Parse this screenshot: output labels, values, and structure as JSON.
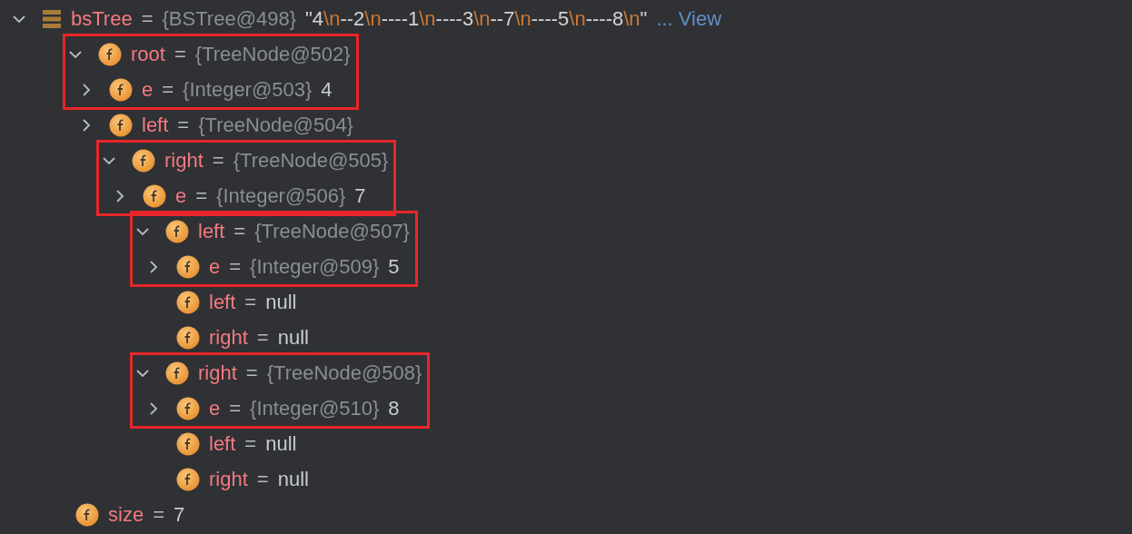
{
  "tree": [
    {
      "kind": "object",
      "name": "bsTree",
      "sep": "=",
      "expanded": true,
      "ref": "{BSTree@498}",
      "string": "\"4\\n--2\\n----1\\n----3\\n--7\\n----5\\n----8\\n\"",
      "link": "... View",
      "children": [
        {
          "kind": "field",
          "name": "root",
          "sep": "=",
          "expanded": true,
          "boxed": true,
          "ref": "{TreeNode@502}",
          "children": [
            {
              "kind": "field",
              "name": "e",
              "sep": "=",
              "expanded": false,
              "ref": "{Integer@503}",
              "value": "4"
            },
            {
              "kind": "field",
              "name": "left",
              "sep": "=",
              "expanded": false,
              "ref": "{TreeNode@504}"
            },
            {
              "kind": "field",
              "name": "right",
              "sep": "=",
              "expanded": true,
              "boxed": true,
              "ref": "{TreeNode@505}",
              "children": [
                {
                  "kind": "field",
                  "name": "e",
                  "sep": "=",
                  "expanded": false,
                  "ref": "{Integer@506}",
                  "value": "7"
                },
                {
                  "kind": "field",
                  "name": "left",
                  "sep": "=",
                  "expanded": true,
                  "boxed": true,
                  "ref": "{TreeNode@507}",
                  "children": [
                    {
                      "kind": "field",
                      "name": "e",
                      "sep": "=",
                      "expanded": false,
                      "ref": "{Integer@509}",
                      "value": "5"
                    },
                    {
                      "kind": "field",
                      "name": "left",
                      "sep": "=",
                      "value": "null"
                    },
                    {
                      "kind": "field",
                      "name": "right",
                      "sep": "=",
                      "value": "null"
                    }
                  ]
                },
                {
                  "kind": "field",
                  "name": "right",
                  "sep": "=",
                  "expanded": true,
                  "boxed": true,
                  "ref": "{TreeNode@508}",
                  "children": [
                    {
                      "kind": "field",
                      "name": "e",
                      "sep": "=",
                      "expanded": false,
                      "ref": "{Integer@510}",
                      "value": "8"
                    },
                    {
                      "kind": "field",
                      "name": "left",
                      "sep": "=",
                      "value": "null"
                    },
                    {
                      "kind": "field",
                      "name": "right",
                      "sep": "=",
                      "value": "null"
                    }
                  ]
                }
              ]
            }
          ]
        },
        {
          "kind": "field",
          "name": "size",
          "sep": "=",
          "value": "7"
        }
      ]
    }
  ]
}
